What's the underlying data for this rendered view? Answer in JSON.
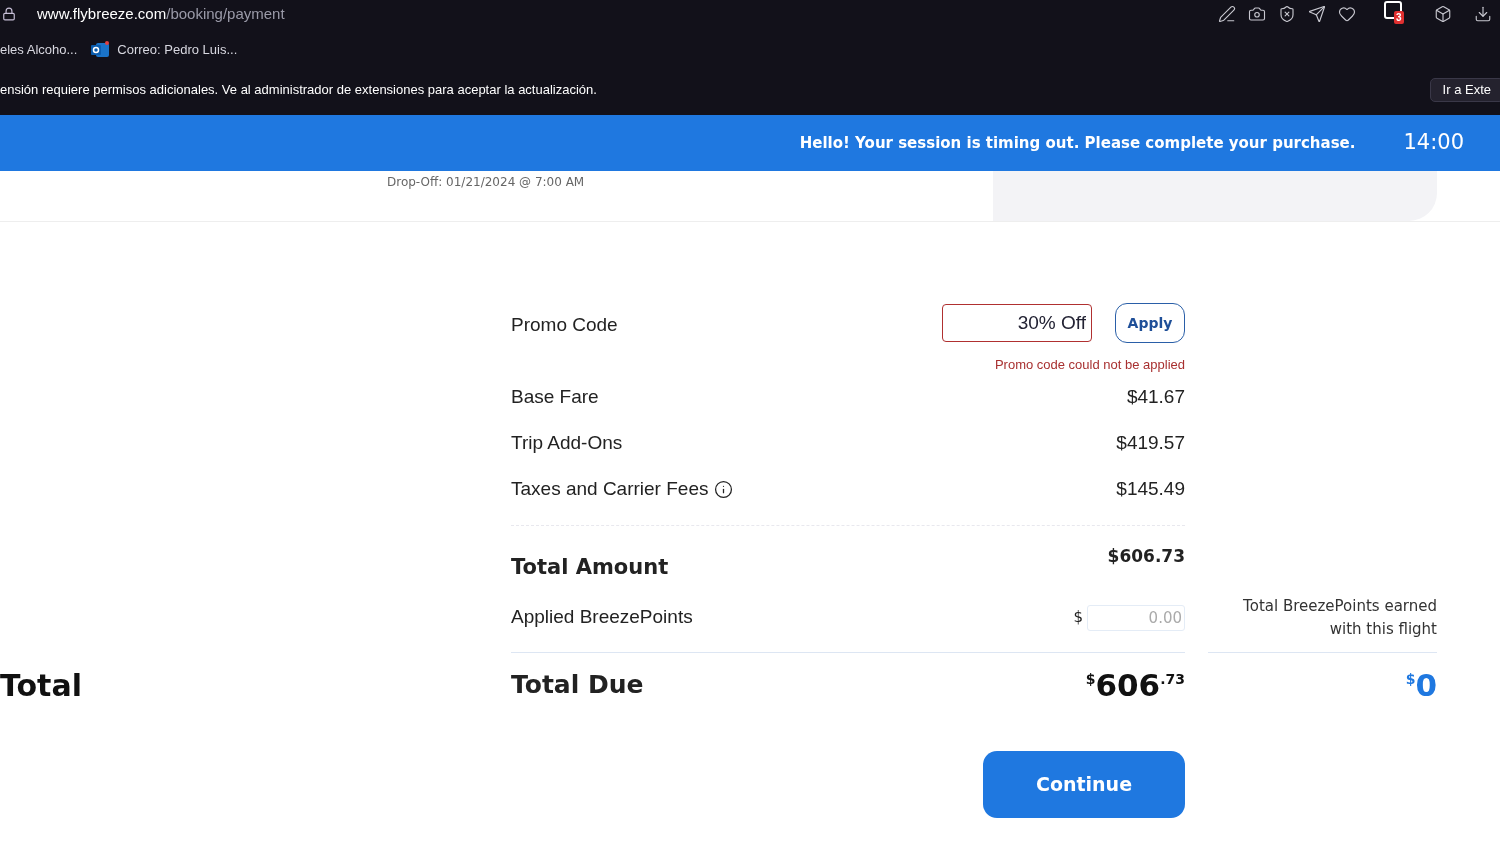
{
  "browser": {
    "url_domain": "www.flybreeze.com",
    "url_path": "/booking/payment",
    "bookmarks": [
      {
        "label": "eles Alcoho...",
        "kind": "plain"
      },
      {
        "label": "Correo: Pedro Luis...",
        "kind": "outlook"
      }
    ],
    "extension_badge": "3",
    "notice": "ensión requiere permisos adicionales. Ve al administrador de extensiones para aceptar la actualización.",
    "notice_button": "Ir a Exte"
  },
  "session_banner": {
    "message": "Hello! Your session is timing out. Please complete your purchase.",
    "timer": "14:00"
  },
  "trip": {
    "dropoff": "Drop-Off: 01/21/2024 @ 7:00 AM"
  },
  "side_heading": "Total",
  "promo": {
    "label": "Promo Code",
    "value": "30% Off",
    "error": "Promo code could not be applied",
    "button": "Apply"
  },
  "lines": [
    {
      "label": "Base Fare",
      "amount": "$41.67",
      "info": false
    },
    {
      "label": "Trip Add-Ons",
      "amount": "$419.57",
      "info": false
    },
    {
      "label": "Taxes and Carrier Fees",
      "amount": "$145.49",
      "info": true
    }
  ],
  "total_amount": {
    "label": "Total Amount",
    "amount": "$606.73"
  },
  "points": {
    "label": "Applied BreezePoints",
    "currency": "$",
    "placeholder": "0.00",
    "earned_label": "Total BreezePoints earned with this flight"
  },
  "total_due": {
    "label": "Total Due",
    "currency": "$",
    "whole": "606",
    "cents": ".73",
    "earned_currency": "$",
    "earned": "0"
  },
  "continue_button": "Continue"
}
